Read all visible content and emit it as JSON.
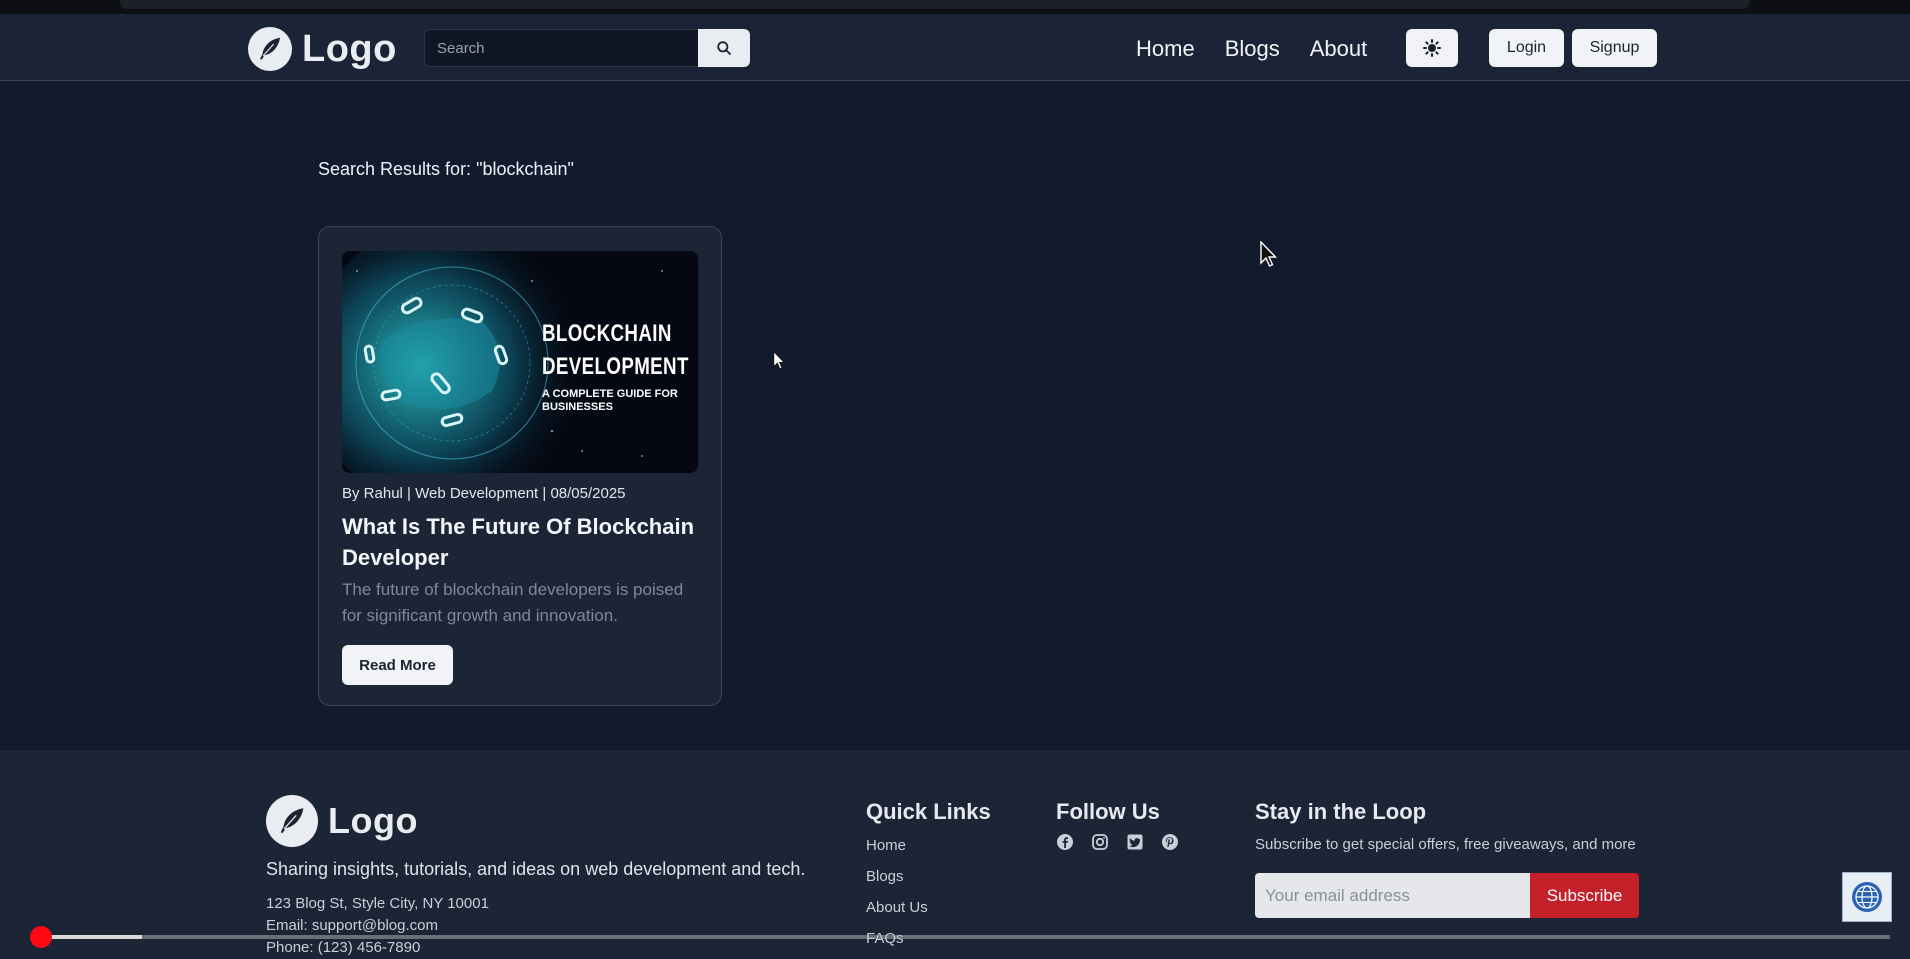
{
  "navbar": {
    "logo_text": "Logo",
    "search_placeholder": "Search",
    "links": [
      "Home",
      "Blogs",
      "About"
    ],
    "login_label": "Login",
    "signup_label": "Signup"
  },
  "main": {
    "results_heading": "Search Results for: \"blockchain\"",
    "card": {
      "image_title": "BLOCKCHAIN DEVELOPMENT",
      "image_subtitle": "A COMPLETE GUIDE FOR BUSINESSES",
      "meta": "By Rahul | Web Development | 08/05/2025",
      "title": "What Is The Future Of Blockchain Developer",
      "description": "The future of blockchain developers is poised for significant growth and innovation.",
      "read_more_label": "Read More"
    }
  },
  "footer": {
    "logo_text": "Logo",
    "tagline": "Sharing insights, tutorials, and ideas on web development and tech.",
    "address": "123 Blog St, Style City, NY 10001",
    "email": "Email: support@blog.com",
    "phone": "Phone: (123) 456-7890",
    "quick_links_heading": "Quick Links",
    "quick_links": [
      "Home",
      "Blogs",
      "About Us",
      "FAQs"
    ],
    "follow_heading": "Follow Us",
    "social_icons": [
      "facebook-icon",
      "instagram-icon",
      "twitter-icon",
      "pinterest-icon"
    ],
    "loop_heading": "Stay in the Loop",
    "loop_subtext": "Subscribe to get special offers, free giveaways, and more",
    "email_placeholder": "Your email address",
    "subscribe_label": "Subscribe"
  },
  "video_overlay": {
    "progress_fraction": 0.033,
    "buffered_fraction": 0.055
  },
  "colors": {
    "page_bg": "#121a2e",
    "navbar_bg": "#1b2436",
    "card_bg": "#1c2536",
    "subscribe_red": "#c4202a",
    "progress_red": "#ff0a14"
  }
}
